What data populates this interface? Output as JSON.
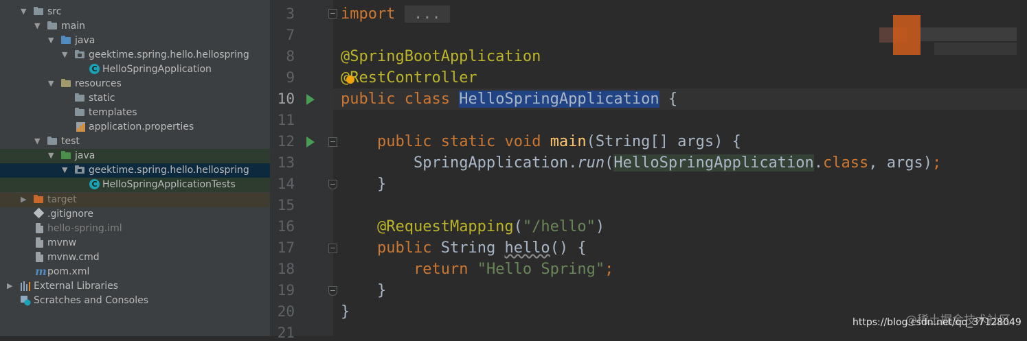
{
  "project_tree": {
    "items": [
      {
        "label": "src"
      },
      {
        "label": "main"
      },
      {
        "label": "java"
      },
      {
        "label": "geektime.spring.hello.hellospring"
      },
      {
        "label": "HelloSpringApplication"
      },
      {
        "label": "resources"
      },
      {
        "label": "static"
      },
      {
        "label": "templates"
      },
      {
        "label": "application.properties"
      },
      {
        "label": "test"
      },
      {
        "label": "java"
      },
      {
        "label": "geektime.spring.hello.hellospring"
      },
      {
        "label": "HelloSpringApplicationTests"
      },
      {
        "label": "target"
      },
      {
        "label": ".gitignore"
      },
      {
        "label": "hello-spring.iml"
      },
      {
        "label": "mvnw"
      },
      {
        "label": "mvnw.cmd"
      },
      {
        "label": "pom.xml"
      },
      {
        "label": "External Libraries"
      },
      {
        "label": "Scratches and Consoles"
      }
    ]
  },
  "editor": {
    "line_numbers": [
      "3",
      "7",
      "8",
      "9",
      "10",
      "11",
      "12",
      "13",
      "14",
      "15",
      "16",
      "17",
      "18",
      "19",
      "20",
      "21"
    ],
    "current_line": "10",
    "tokens": {
      "import_kw": "import",
      "import_fold": " ... ",
      "ann_springboot": "@SpringBootApplication",
      "ann_rest_at": "@",
      "ann_rest_rest": "RestController",
      "l10_public": "public",
      "l10_class": "class",
      "l10_name": "HelloSpringApplication",
      "l10_brace": "{",
      "l12_public": "public",
      "l12_static": "static",
      "l12_void": "void",
      "l12_main": "main",
      "l12_params": "(String[] args) {",
      "l13_springapp": "SpringApplication.",
      "l13_run": "run",
      "l13_open": "(",
      "l13_cls": "HelloSpringApplication",
      "l13_dot": ".",
      "l13_class_kw": "class",
      "l13_comma": ", args)",
      "l13_semi": ";",
      "l14_brace": "}",
      "l16_ann": "@RequestMapping",
      "l16_open": "(",
      "l16_str": "\"/hello\"",
      "l16_close": ")",
      "l17_public": "public",
      "l17_type": "String",
      "l17_hello": "hello",
      "l17_rest": "() {",
      "l18_return": "return",
      "l18_str": "\"Hello Spring\"",
      "l18_semi": ";",
      "l19_brace": "}",
      "l20_brace": "}"
    }
  },
  "watermark": {
    "site": "@稀土掘金技术社区",
    "url": "https://blog.csdn.net/qq_37128049"
  },
  "colors": {
    "keyword": "#cc7832",
    "annotation": "#bbb529",
    "string": "#6a8759",
    "method_decl": "#ffc66d",
    "plain": "#a9b7c6",
    "selection": "#214283",
    "run_icon": "#499c54"
  }
}
